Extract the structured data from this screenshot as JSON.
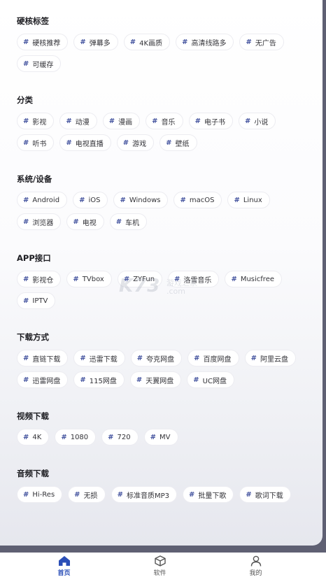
{
  "sections": [
    {
      "title": "硬核标签",
      "tags": [
        "硬核推荐",
        "弹幕多",
        "4K画质",
        "高清线路多",
        "无广告",
        "可缓存"
      ]
    },
    {
      "title": "分类",
      "tags": [
        "影视",
        "动漫",
        "漫画",
        "音乐",
        "电子书",
        "小说",
        "听书",
        "电视直播",
        "游戏",
        "壁纸"
      ]
    },
    {
      "title": "系统/设备",
      "tags": [
        "Android",
        "iOS",
        "Windows",
        "macOS",
        "Linux",
        "浏览器",
        "电视",
        "车机"
      ]
    },
    {
      "title": "APP接口",
      "tags": [
        "影视仓",
        "TVbox",
        "ZYFun",
        "洛雪音乐",
        "Musicfree",
        "IPTV"
      ]
    },
    {
      "title": "下载方式",
      "tags": [
        "直链下载",
        "迅雷下载",
        "夸克网盘",
        "百度网盘",
        "阿里云盘",
        "迅雷网盘",
        "115网盘",
        "天翼网盘",
        "UC网盘"
      ]
    },
    {
      "title": "视频下载",
      "tags": [
        "4K",
        "1080",
        "720",
        "MV"
      ]
    },
    {
      "title": "音频下载",
      "tags": [
        "Hi-Res",
        "无损",
        "标准音质MP3",
        "批量下歌",
        "歌词下载"
      ]
    }
  ],
  "tag_prefix": "#",
  "watermark": {
    "logo": "K73",
    "line1": "游戏之家",
    "line2": ".com"
  },
  "nav": [
    {
      "label": "首页",
      "icon": "home-icon",
      "active": true
    },
    {
      "label": "软件",
      "icon": "cube-icon",
      "active": false
    },
    {
      "label": "我的",
      "icon": "user-icon",
      "active": false
    }
  ],
  "colors": {
    "accent": "#2b4fb7",
    "hash": "#3f4f9c"
  }
}
